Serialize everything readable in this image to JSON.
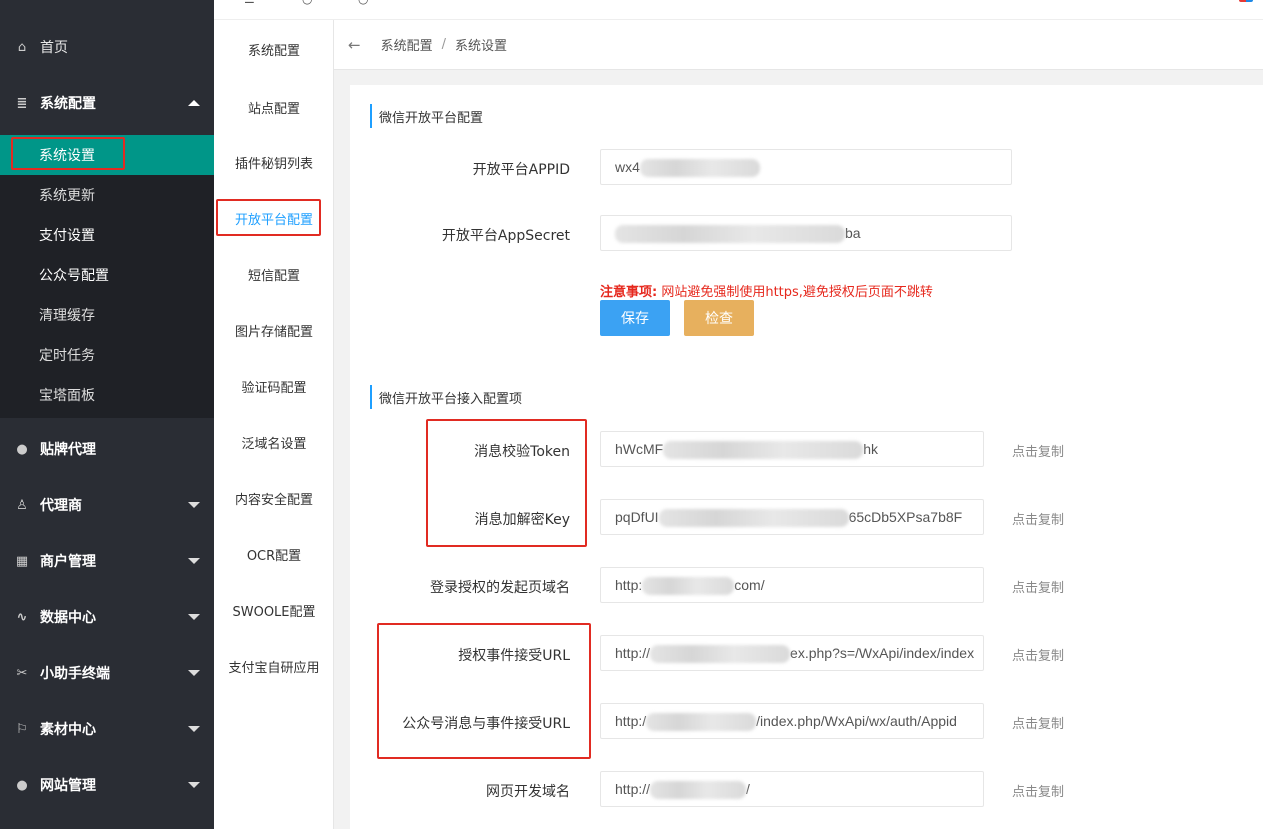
{
  "sidebar": {
    "items": [
      {
        "label": "首页",
        "icon": "home-icon",
        "glyph": "⌂"
      },
      {
        "label": "系统配置",
        "icon": "config-icon",
        "glyph": "≣"
      },
      {
        "label": "贴牌代理",
        "icon": "user-icon",
        "glyph": "👤"
      },
      {
        "label": "代理商",
        "icon": "agent-icon",
        "glyph": "♙"
      },
      {
        "label": "商户管理",
        "icon": "grid-icon",
        "glyph": "▦"
      },
      {
        "label": "数据中心",
        "icon": "pulse-icon",
        "glyph": "∿"
      },
      {
        "label": "小助手终端",
        "icon": "tool-icon",
        "glyph": "✂"
      },
      {
        "label": "素材中心",
        "icon": "flag-icon",
        "glyph": "⚐"
      },
      {
        "label": "网站管理",
        "icon": "globe-icon",
        "glyph": "●"
      }
    ],
    "sub_items": [
      "系统设置",
      "系统更新",
      "支付设置",
      "公众号配置",
      "清理缓存",
      "定时任务",
      "宝塔面板"
    ]
  },
  "subnav": {
    "items": [
      "系统配置",
      "站点配置",
      "插件秘钥列表",
      "开放平台配置",
      "短信配置",
      "图片存储配置",
      "验证码配置",
      "泛域名设置",
      "内容安全配置",
      "OCR配置",
      "SWOOLE配置",
      "支付宝自研应用"
    ]
  },
  "breadcrumb": {
    "back": "←",
    "parent": "系统配置",
    "separator": "/",
    "current": "系统设置"
  },
  "section1": {
    "title": "微信开放平台配置",
    "appid_label": "开放平台APPID",
    "appid_value": "wx4",
    "secret_label": "开放平台AppSecret",
    "secret_value": "ba",
    "notice_prefix": "注意事项:",
    "notice_text": "网站避免强制使用https,避免授权后页面不跳转",
    "save_label": "保存",
    "check_label": "检查"
  },
  "section2": {
    "title": "微信开放平台接入配置项",
    "copy_label": "点击复制",
    "rows": [
      {
        "label": "消息校验Token",
        "prefix": "hWcMF",
        "suffix": "hk"
      },
      {
        "label": "消息加解密Key",
        "prefix": "pqDfUI",
        "suffix": "65cDb5XPsa7b8F"
      },
      {
        "label": "登录授权的发起页域名",
        "prefix": "http:",
        "suffix": "com/"
      },
      {
        "label": "授权事件接受URL",
        "prefix": "http://",
        "suffix": "ex.php?s=/WxApi/index/index"
      },
      {
        "label": "公众号消息与事件接受URL",
        "prefix": "http:/",
        "suffix": "/index.php/WxApi/wx/auth/Appid"
      },
      {
        "label": "网页开发域名",
        "prefix": "http://",
        "suffix": "/"
      }
    ]
  },
  "colors": {
    "accent": "#009688",
    "link": "#1e9fff",
    "highlight": "#e12b22",
    "save": "#3ba2f3",
    "check": "#e7b05e"
  }
}
